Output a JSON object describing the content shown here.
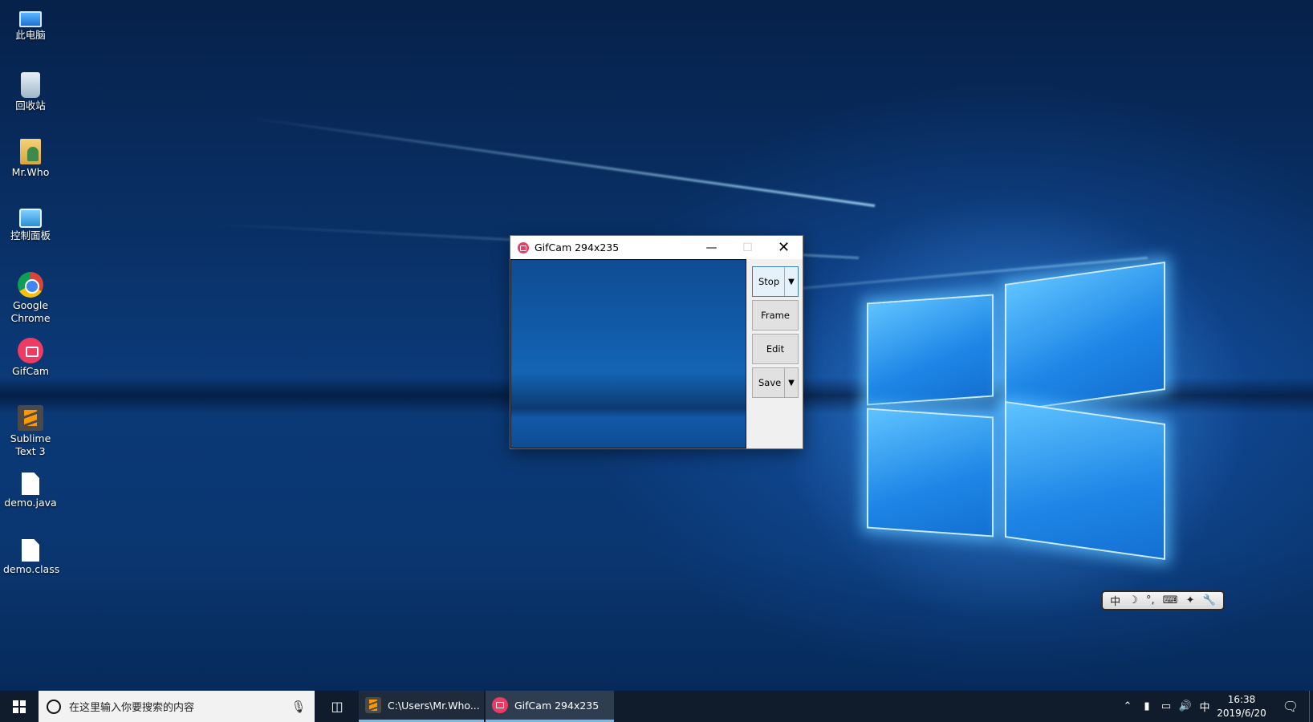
{
  "desktop": {
    "icons": [
      {
        "label": "此电脑"
      },
      {
        "label": "回收站"
      },
      {
        "label": "Mr.Who"
      },
      {
        "label": "控制面板"
      },
      {
        "label": "Google\nChrome"
      },
      {
        "label": "GifCam"
      },
      {
        "label": "Sublime\nText 3"
      },
      {
        "label": "demo.java"
      },
      {
        "label": "demo.class"
      }
    ]
  },
  "gifcam_window": {
    "title": "GifCam 294x235",
    "buttons": {
      "record": "Stop",
      "frame": "Frame",
      "edit": "Edit",
      "save": "Save"
    }
  },
  "ime_bar": {
    "items": [
      "中",
      "☽",
      "°,",
      "⌨",
      "✦",
      "🔧"
    ]
  },
  "taskbar": {
    "search_placeholder": "在这里输入你要搜索的内容",
    "tasks": [
      {
        "label": "C:\\Users\\Mr.Who..."
      },
      {
        "label": "GifCam 294x235"
      }
    ],
    "tray": {
      "ime_indicator": "中"
    },
    "clock": {
      "time": "16:38",
      "date": "2019/6/20"
    }
  }
}
